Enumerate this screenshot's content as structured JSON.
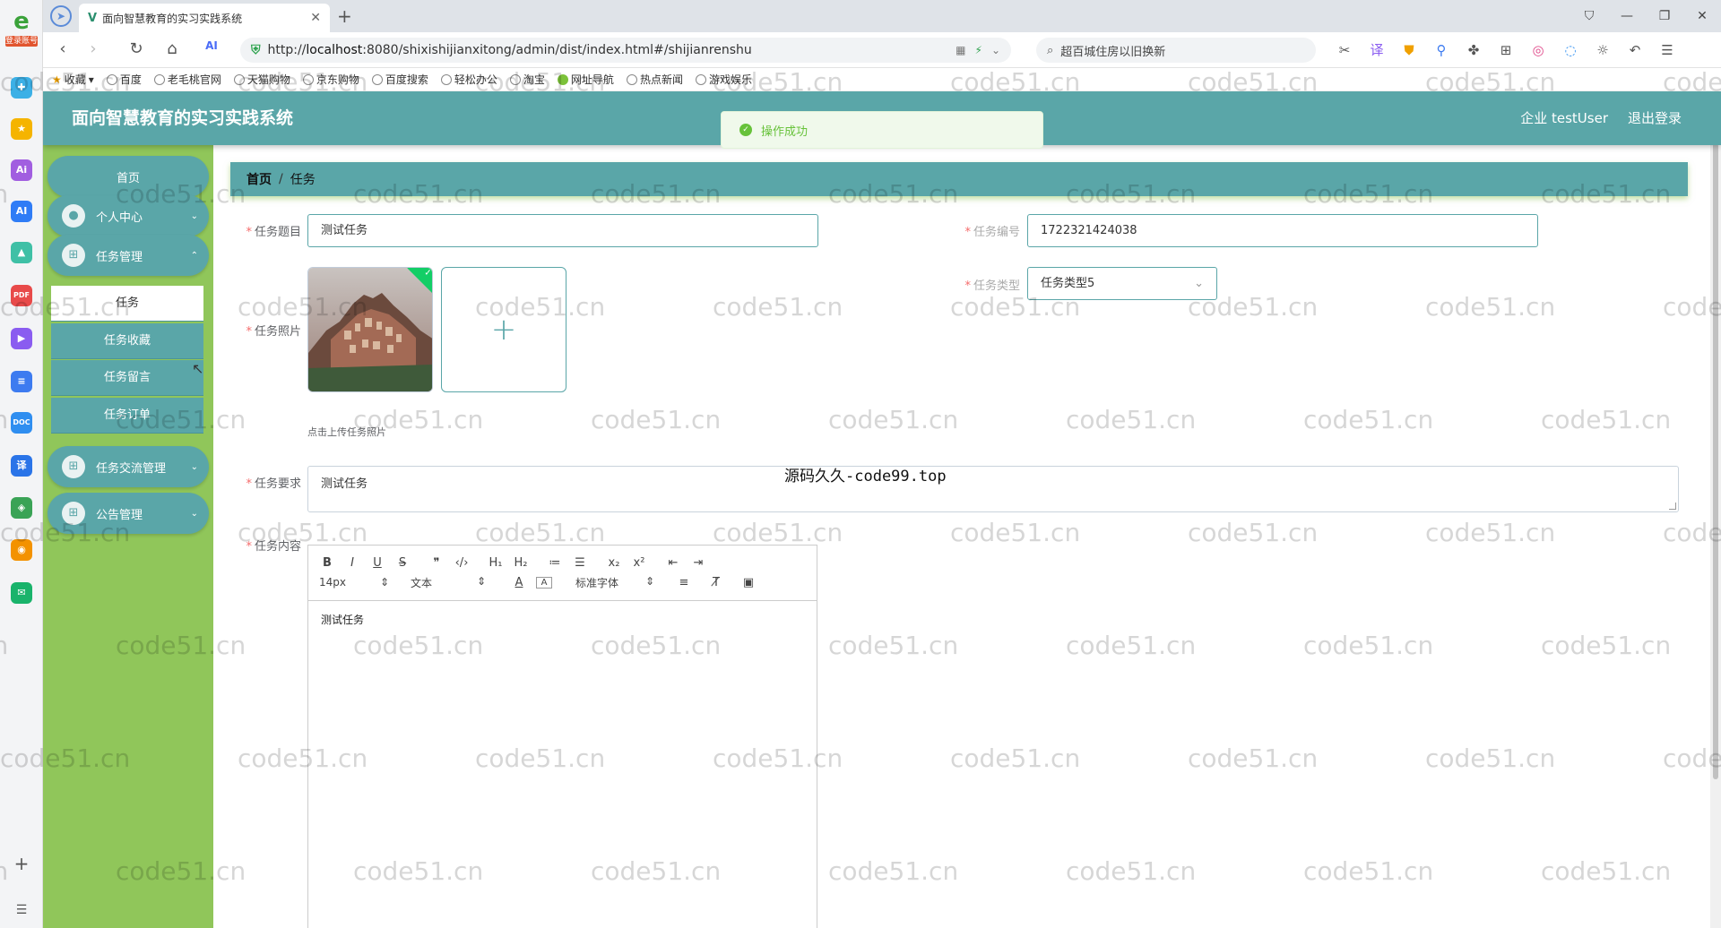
{
  "browser": {
    "rail_tag": "登录账号",
    "tab_title": "面向智慧教育的实习实践系统",
    "url_prefix": "http://",
    "url_host": "localhost",
    "url_rest": ":8080/shixishijianxitong/admin/dist/index.html#/shijianrenshu",
    "search_text": "超百城住房以旧换新",
    "bookmarks": [
      "收藏",
      "百度",
      "老毛桃官网",
      "天猫购物",
      "京东购物",
      "百度搜索",
      "轻松办公",
      "淘宝",
      "网址导航",
      "热点新闻",
      "游戏娱乐"
    ]
  },
  "app": {
    "title": "面向智慧教育的实习实践系统",
    "user_label": "企业 testUser",
    "logout_label": "退出登录",
    "toast": "操作成功"
  },
  "sidebar": {
    "home": "首页",
    "personal": "个人中心",
    "task_mgmt": "任务管理",
    "sub_items": [
      "任务",
      "任务收藏",
      "任务留言",
      "任务订单"
    ],
    "task_exchange": "任务交流管理",
    "notice_mgmt": "公告管理"
  },
  "breadcrumb": {
    "home": "首页",
    "separator": "/",
    "current": "任务"
  },
  "form": {
    "title_label": "任务题目",
    "title_value": "测试任务",
    "number_label": "任务编号",
    "number_value": "1722321424038",
    "type_label": "任务类型",
    "type_value": "任务类型5",
    "photo_label": "任务照片",
    "upload_tip": "点击上传任务照片",
    "requirement_label": "任务要求",
    "requirement_value": "测试任务",
    "content_label": "任务内容",
    "content_value": "测试任务"
  },
  "editor": {
    "font_size": "14px",
    "paragraph": "文本",
    "font_family": "标准字体"
  },
  "overlay_text": "源码久久-code99.top",
  "watermark": "code51.cn"
}
